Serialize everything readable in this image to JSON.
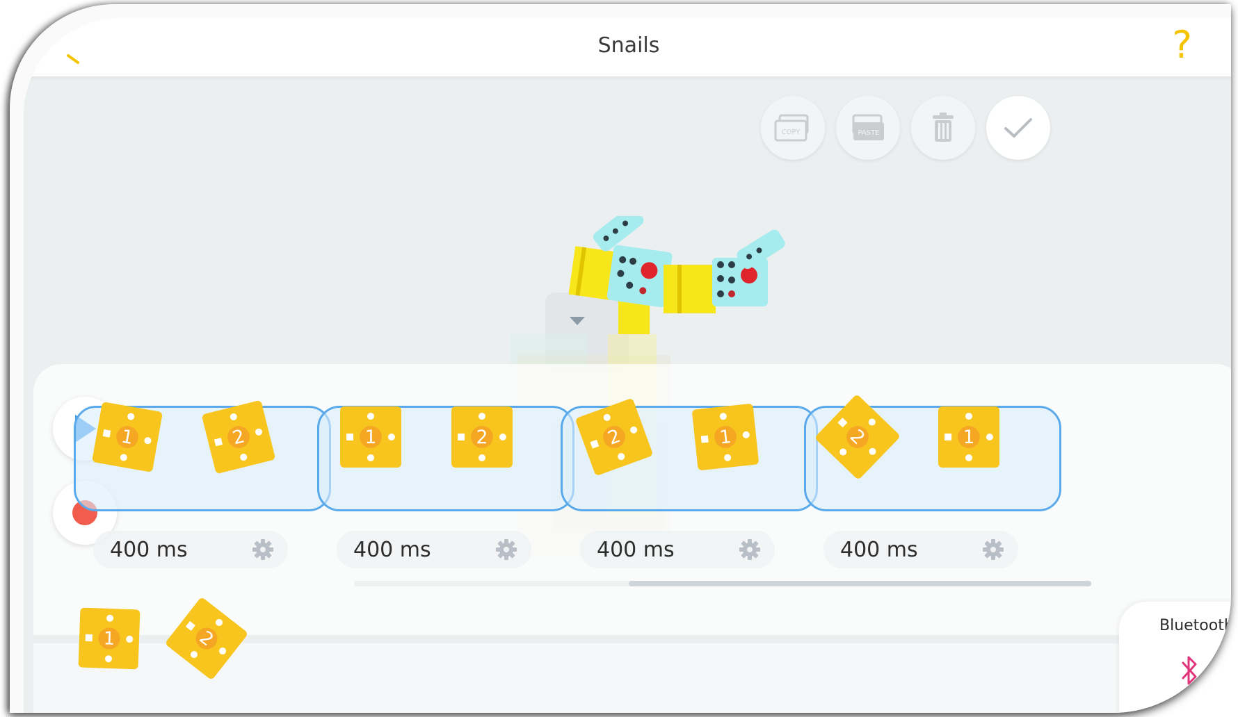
{
  "app": {
    "title": "Snails"
  },
  "toolbar": {
    "copy_label": "COPY",
    "paste_label": "PASTE",
    "delete_icon": "trash-icon",
    "confirm_icon": "check-icon"
  },
  "help": {
    "symbol": "?"
  },
  "playback": {
    "play_icon": "play-icon",
    "record_icon": "record-icon"
  },
  "timeline": {
    "frames": [
      {
        "duration": "400 ms",
        "tiles": [
          "1",
          "2"
        ]
      },
      {
        "duration": "400 ms",
        "tiles": [
          "1",
          "2"
        ]
      },
      {
        "duration": "400 ms",
        "tiles": [
          "2",
          "1"
        ]
      },
      {
        "duration": "400 ms",
        "tiles": [
          "2",
          "1"
        ]
      }
    ]
  },
  "palette": {
    "tiles": [
      "1",
      "2"
    ]
  },
  "connection": {
    "label": "Bluetooth",
    "icon": "bluetooth-icon"
  },
  "colors": {
    "accent_yellow": "#f7c51e",
    "tile_orange": "#f5a623",
    "frame_blue": "#5aa9ea",
    "play_blue": "#3d9bf0",
    "record_red": "#f25c4c",
    "bluetooth_pink": "#e0357a"
  }
}
